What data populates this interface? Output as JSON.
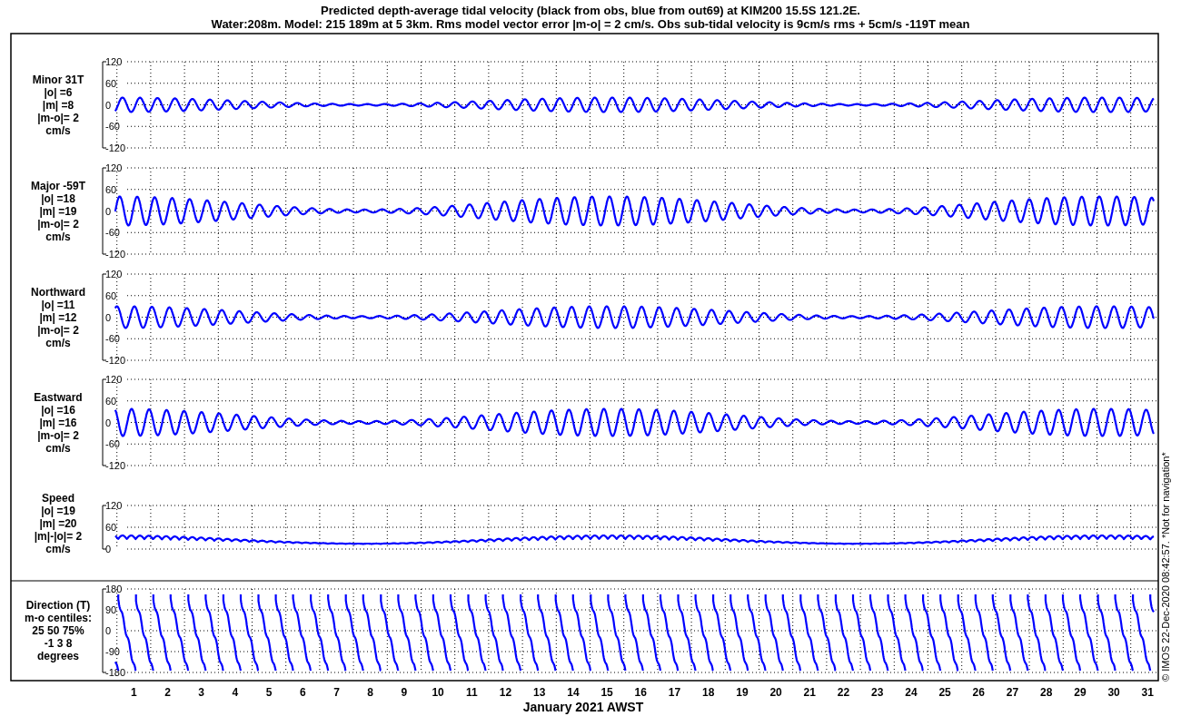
{
  "title_lines": [
    "Predicted depth-average tidal velocity (black from obs, blue from out69) at KIM200 15.5S 121.2E.",
    "Water:208m. Model: 215 189m at 5 3km. Rms model vector error |m-o| = 2 cm/s. Obs sub-tidal velocity is 9cm/s rms + 5cm/s -119T mean"
  ],
  "panels": [
    {
      "kind": "velocity",
      "label_lines": [
        "Minor 31T",
        "|o| =6",
        "|m| =8",
        "|m-o|= 2",
        "cm/s"
      ],
      "yticks": [
        "120",
        "60",
        "0",
        "-60",
        "-120"
      ]
    },
    {
      "kind": "velocity",
      "label_lines": [
        "Major -59T",
        "|o| =18",
        "|m| =19",
        "|m-o|= 2",
        "cm/s"
      ],
      "yticks": [
        "120",
        "60",
        "0",
        "-60",
        "-120"
      ]
    },
    {
      "kind": "velocity",
      "label_lines": [
        "Northward",
        "|o| =11",
        "|m| =12",
        "|m-o|= 2",
        "cm/s"
      ],
      "yticks": [
        "120",
        "60",
        "0",
        "-60",
        "-120"
      ]
    },
    {
      "kind": "velocity",
      "label_lines": [
        "Eastward",
        "|o| =16",
        "|m| =16",
        "|m-o|= 2",
        "cm/s"
      ],
      "yticks": [
        "120",
        "60",
        "0",
        "-60",
        "-120"
      ]
    },
    {
      "kind": "speed",
      "label_lines": [
        "Speed",
        "|o| =19",
        "|m| =20",
        "|m|-|o|= 2",
        "cm/s"
      ],
      "yticks": [
        "120",
        "60",
        "0"
      ]
    },
    {
      "kind": "direction",
      "label_lines": [
        "Direction (T)",
        "m-o centiles:",
        "25  50  75%",
        "-1  3  8",
        "degrees"
      ],
      "yticks": [
        "180",
        "90",
        "0",
        "-90",
        "-180"
      ]
    }
  ],
  "x_axis": {
    "labels": [
      "1",
      "2",
      "3",
      "4",
      "5",
      "6",
      "7",
      "8",
      "9",
      "10",
      "11",
      "12",
      "13",
      "14",
      "15",
      "16",
      "17",
      "18",
      "19",
      "20",
      "21",
      "22",
      "23",
      "24",
      "25",
      "26",
      "27",
      "28",
      "29",
      "30",
      "31"
    ],
    "title": "January 2021 AWST"
  },
  "side_note": "© IMOS 22-Dec-2020 08:42:57. *Not for navigation*"
}
